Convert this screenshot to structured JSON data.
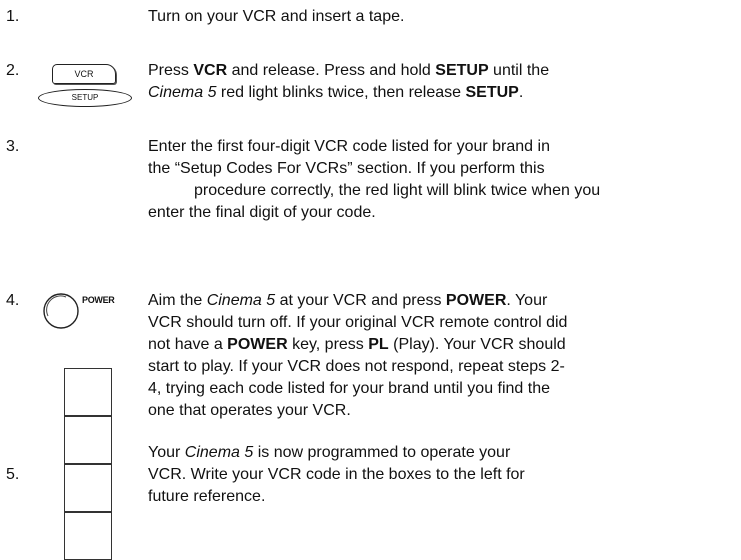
{
  "steps": [
    {
      "number": "1.",
      "lines": [
        [
          {
            "t": "Turn on your VCR and insert a tape."
          }
        ]
      ]
    },
    {
      "number": "2.",
      "lines": [
        [
          {
            "t": "Press "
          },
          {
            "t": "VCR",
            "b": true
          },
          {
            "t": " and release. Press and hold "
          },
          {
            "t": "SETUP",
            "b": true
          },
          {
            "t": " until the"
          }
        ],
        [
          {
            "t": "Cinema 5",
            "i": true
          },
          {
            "t": " red light blinks twice, then release "
          },
          {
            "t": "SETUP",
            "b": true
          },
          {
            "t": "."
          }
        ]
      ]
    },
    {
      "number": "3.",
      "lines": [
        [
          {
            "t": "Enter the first four-digit VCR code listed for your brand in"
          }
        ],
        [
          {
            "t": "the “Setup Codes For VCRs” section. If you perform this"
          }
        ],
        [
          {
            "t": "procedure correctly, the red light will blink twice when you",
            "indent": true
          }
        ],
        [
          {
            "t": "enter the final digit of your code."
          }
        ]
      ]
    },
    {
      "number": "4.",
      "lines": [
        [
          {
            "t": "Aim the "
          },
          {
            "t": "Cinema 5",
            "i": true
          },
          {
            "t": " at your VCR and press "
          },
          {
            "t": "POWER",
            "b": true
          },
          {
            "t": ". Your"
          }
        ],
        [
          {
            "t": "VCR should turn off. If your original VCR remote control did"
          }
        ],
        [
          {
            "t": "not have a "
          },
          {
            "t": "POWER",
            "b": true
          },
          {
            "t": " key, press "
          },
          {
            "t": "PL",
            "b": true
          },
          {
            "t": " (Play). Your VCR should"
          }
        ],
        [
          {
            "t": "start to play. If your VCR does not respond, repeat steps 2-"
          }
        ],
        [
          {
            "t": "4, trying each code listed for your brand until you find the"
          }
        ],
        [
          {
            "t": "one that operates your VCR."
          }
        ]
      ]
    },
    {
      "number": "5.",
      "lines": [
        [
          {
            "t": "Your "
          },
          {
            "t": "Cinema 5",
            "i": true
          },
          {
            "t": " is now programmed to operate your"
          }
        ],
        [
          {
            "t": "VCR. Write your VCR code in the boxes to the left for"
          }
        ],
        [
          {
            "t": "future reference."
          }
        ]
      ]
    }
  ],
  "keys": {
    "vcr": "VCR",
    "setup": "SETUP",
    "power": "POWER"
  }
}
